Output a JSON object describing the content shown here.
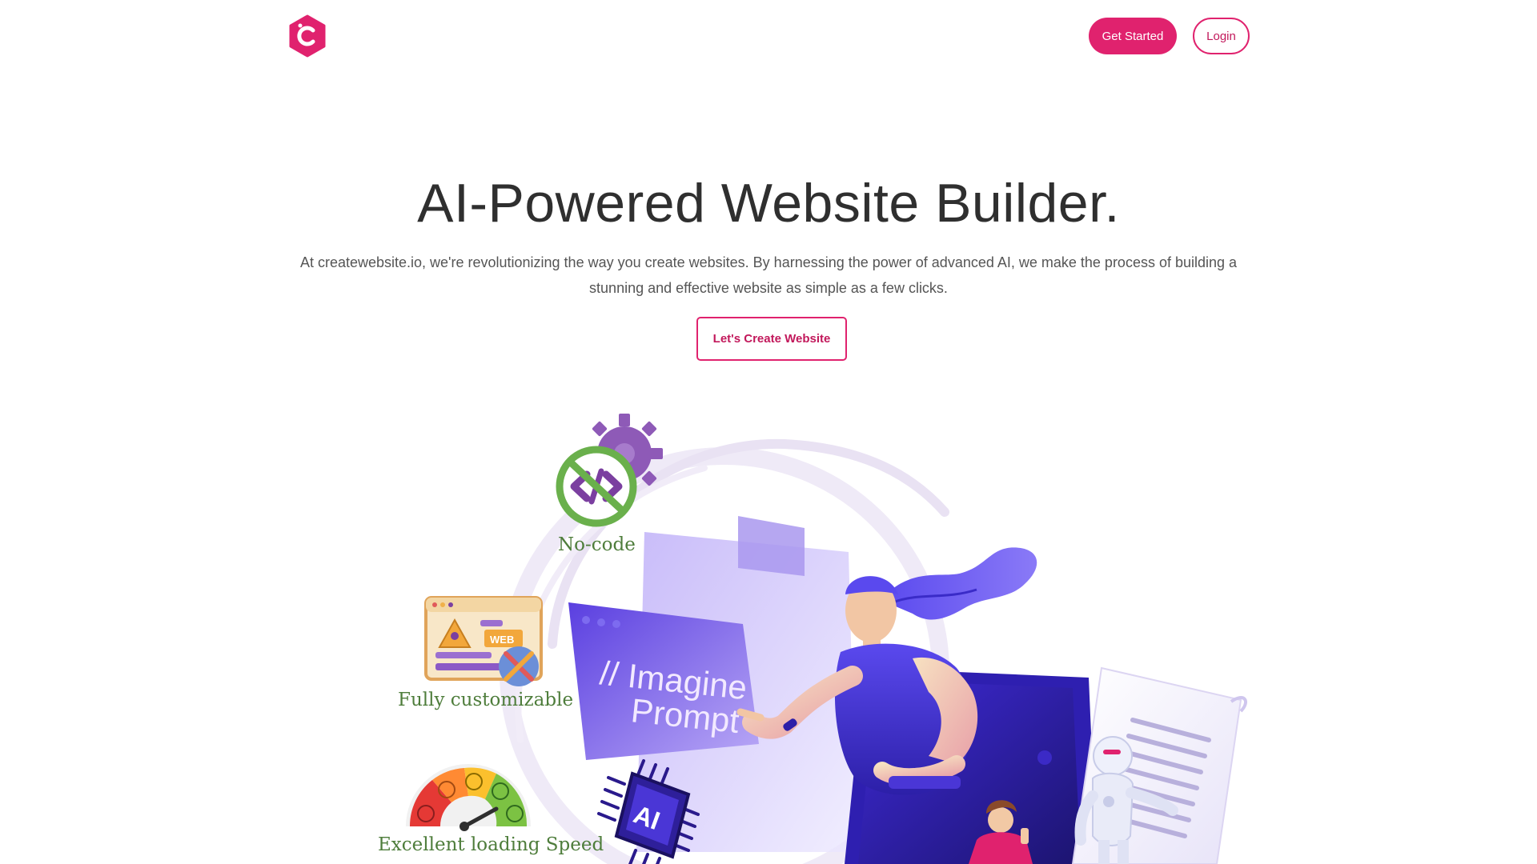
{
  "header": {
    "logo_letter": "C",
    "get_started_label": "Get Started",
    "login_label": "Login"
  },
  "hero": {
    "title": "AI-Powered Website Builder.",
    "description": "At createwebsite.io, we're revolutionizing the way you create websites. By harnessing the power of advanced AI, we make the process of building a stunning and effective website as simple as a few clicks.",
    "cta_label": "Let's Create Website"
  },
  "illustration": {
    "features": {
      "no_code": "No-code",
      "customizable": "Fully customizable",
      "speed": "Excellent  loading Speed"
    },
    "prompt_line1": "// Imagine",
    "prompt_line2": "Prompt",
    "chip_label": "AI",
    "web_badge": "WEB"
  },
  "colors": {
    "brand_pink": "#e0226e",
    "text_dark": "#2f2f2f",
    "text_muted": "#555555",
    "feature_green": "#4e7d3b",
    "illustration_purple": "#6a4cf0"
  },
  "icons": {
    "logo": "createwebsite-hexagon-logo-icon",
    "no_code": "code-gear-icon",
    "customizable": "web-tools-icon",
    "speed": "speedometer-icon",
    "chip": "ai-chip-icon"
  }
}
